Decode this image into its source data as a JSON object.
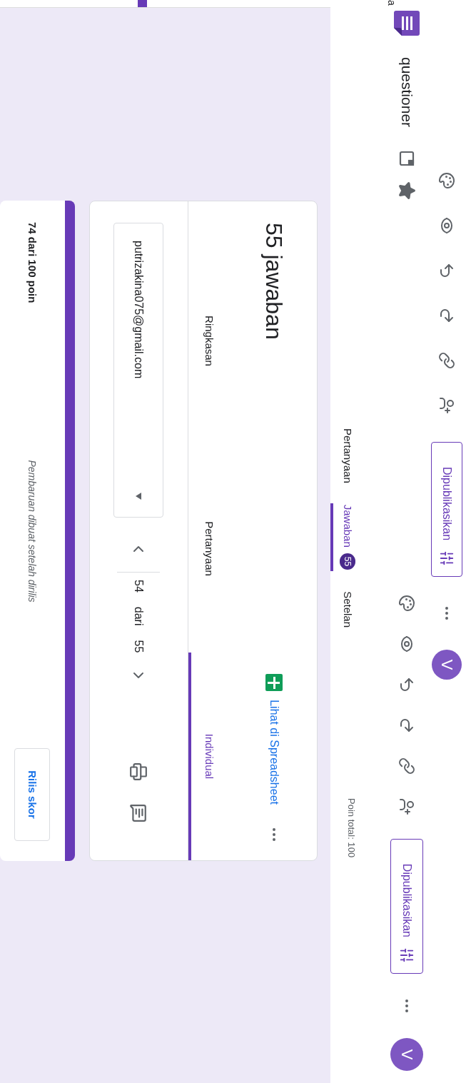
{
  "header": {
    "partial_text": "a",
    "form_title": "questioner"
  },
  "toolbars": [
    {
      "publish_label": "Dipublikasikan",
      "avatar": "V"
    },
    {
      "publish_label": "Dipublikasikan",
      "avatar": "V"
    }
  ],
  "tabs": [
    {
      "label": "Pertanyaan",
      "selected": false
    },
    {
      "label": "Jawaban",
      "badge": "55",
      "selected": true
    },
    {
      "label": "Setelan",
      "selected": false
    }
  ],
  "points_total": "Poin total: 100",
  "responses": {
    "title": "55 jawaban",
    "sheet_link": "Lihat di Spreadsheet",
    "tabs": [
      {
        "label": "Ringkasan",
        "selected": false
      },
      {
        "label": "Pertanyaan",
        "selected": false
      },
      {
        "label": "Individual",
        "selected": true
      }
    ],
    "respondent": "putrizakina075@gmail.com",
    "index": "54",
    "of": "dari",
    "total": "55"
  },
  "score_card": {
    "score": "74 dari 100 poin",
    "note": "Pembaruan dibuat setelah dirilis",
    "button": "Rilis skor"
  }
}
